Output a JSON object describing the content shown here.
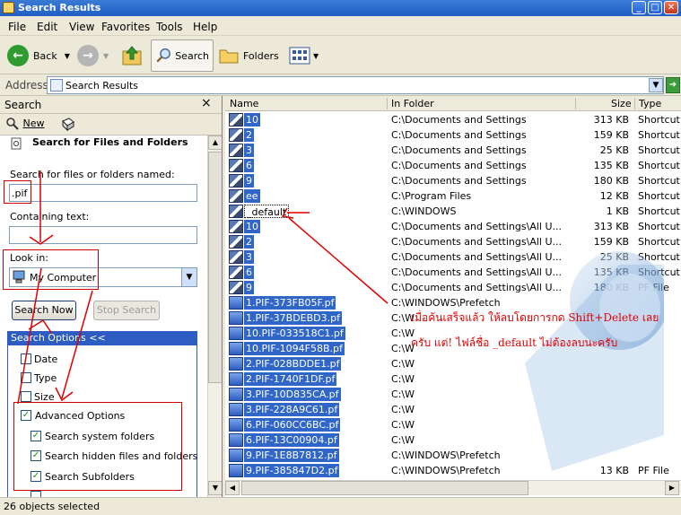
{
  "window": {
    "title": "Search Results"
  },
  "menu": [
    "File",
    "Edit",
    "View",
    "Favorites",
    "Tools",
    "Help"
  ],
  "toolbar": {
    "back": "Back",
    "search": "Search",
    "folders": "Folders"
  },
  "address": {
    "label": "Address",
    "value": "Search Results"
  },
  "search_pane": {
    "title": "Search",
    "close": "×",
    "new_label": "New",
    "heading": "Search for Files and Folders",
    "named_label": "Search for files or folders named:",
    "named_value": ".pif",
    "containing_label": "Containing text:",
    "containing_value": "",
    "lookin_label": "Look in:",
    "lookin_value": "My Computer",
    "search_now": "Search Now",
    "stop_search": "Stop Search",
    "options_title": "Search Options <<",
    "options": [
      {
        "label": "Date",
        "checked": false
      },
      {
        "label": "Type",
        "checked": false
      },
      {
        "label": "Size",
        "checked": false
      },
      {
        "label": "Advanced Options",
        "checked": true
      },
      {
        "label": "Search system folders",
        "checked": true
      },
      {
        "label": "Search hidden files and folders",
        "checked": true
      },
      {
        "label": "Search Subfolders",
        "checked": true
      }
    ]
  },
  "columns": {
    "name": "Name",
    "folder": "In Folder",
    "size": "Size",
    "type": "Type"
  },
  "files": [
    {
      "name": "10",
      "folder": "C:\\Documents and Settings",
      "size": "313 KB",
      "type": "Shortcut t",
      "icon": "shortcut-icon"
    },
    {
      "name": "2",
      "folder": "C:\\Documents and Settings",
      "size": "159 KB",
      "type": "Shortcut t",
      "icon": "shortcut-icon"
    },
    {
      "name": "3",
      "folder": "C:\\Documents and Settings",
      "size": "25 KB",
      "type": "Shortcut t",
      "icon": "shortcut-icon"
    },
    {
      "name": "6",
      "folder": "C:\\Documents and Settings",
      "size": "135 KB",
      "type": "Shortcut t",
      "icon": "shortcut-icon"
    },
    {
      "name": "9",
      "folder": "C:\\Documents and Settings",
      "size": "180 KB",
      "type": "Shortcut t",
      "icon": "shortcut-icon"
    },
    {
      "name": "ee",
      "folder": "C:\\Program Files",
      "size": "12 KB",
      "type": "Shortcut t",
      "icon": "shortcut-icon"
    },
    {
      "name": "_default",
      "folder": "C:\\WINDOWS",
      "size": "1 KB",
      "type": "Shortcut t",
      "icon": "shortcut-icon",
      "focused": true
    },
    {
      "name": "10",
      "folder": "C:\\Documents and Settings\\All U...",
      "size": "313 KB",
      "type": "Shortcut t",
      "icon": "shortcut-icon"
    },
    {
      "name": "2",
      "folder": "C:\\Documents and Settings\\All U...",
      "size": "159 KB",
      "type": "Shortcut t",
      "icon": "shortcut-icon"
    },
    {
      "name": "3",
      "folder": "C:\\Documents and Settings\\All U...",
      "size": "25 KB",
      "type": "Shortcut t",
      "icon": "shortcut-icon"
    },
    {
      "name": "6",
      "folder": "C:\\Documents and Settings\\All U...",
      "size": "135 KB",
      "type": "Shortcut t",
      "icon": "shortcut-icon"
    },
    {
      "name": "9",
      "folder": "C:\\Documents and Settings\\All U...",
      "size": "180 KB",
      "type": "PF File",
      "icon": "shortcut-icon"
    },
    {
      "name": "1.PIF-373FB05F.pf",
      "folder": "C:\\WINDOWS\\Prefetch",
      "size": "",
      "type": "",
      "icon": "pf-file-icon"
    },
    {
      "name": "1.PIF-37BDEBD3.pf",
      "folder": "C:\\W",
      "size": "",
      "type": "",
      "icon": "pf-file-icon"
    },
    {
      "name": "10.PIF-033518C1.pf",
      "folder": "C:\\W",
      "size": "",
      "type": "",
      "icon": "pf-file-icon"
    },
    {
      "name": "10.PIF-1094F58B.pf",
      "folder": "C:\\W",
      "size": "",
      "type": "",
      "icon": "pf-file-icon"
    },
    {
      "name": "2.PIF-028BDDE1.pf",
      "folder": "C:\\W",
      "size": "",
      "type": "",
      "icon": "pf-file-icon"
    },
    {
      "name": "2.PIF-1740F1DF.pf",
      "folder": "C:\\W",
      "size": "",
      "type": "",
      "icon": "pf-file-icon"
    },
    {
      "name": "3.PIF-10D835CA.pf",
      "folder": "C:\\W",
      "size": "",
      "type": "",
      "icon": "pf-file-icon"
    },
    {
      "name": "3.PIF-228A9C61.pf",
      "folder": "C:\\W",
      "size": "",
      "type": "",
      "icon": "pf-file-icon"
    },
    {
      "name": "6.PIF-060CC6BC.pf",
      "folder": "C:\\W",
      "size": "",
      "type": "",
      "icon": "pf-file-icon"
    },
    {
      "name": "6.PIF-13C00904.pf",
      "folder": "C:\\W",
      "size": "",
      "type": "",
      "icon": "pf-file-icon"
    },
    {
      "name": "9.PIF-1E8B7812.pf",
      "folder": "C:\\WINDOWS\\Prefetch",
      "size": "",
      "type": "",
      "icon": "pf-file-icon"
    },
    {
      "name": "9.PIF-385847D2.pf",
      "folder": "C:\\WINDOWS\\Prefetch",
      "size": "13 KB",
      "type": "PF File",
      "icon": "pf-file-icon"
    }
  ],
  "annotation": {
    "line1": "เมื่อค้นเสร็จแล้ว ให้ลบโดยการกด Shift+Delete เลย",
    "line2": "ครับ แต่! ไฟล์ชื่อ _default ไม่ต้องลบนะครับ",
    "color": "#e00000"
  },
  "status": {
    "text": "26 objects selected"
  }
}
